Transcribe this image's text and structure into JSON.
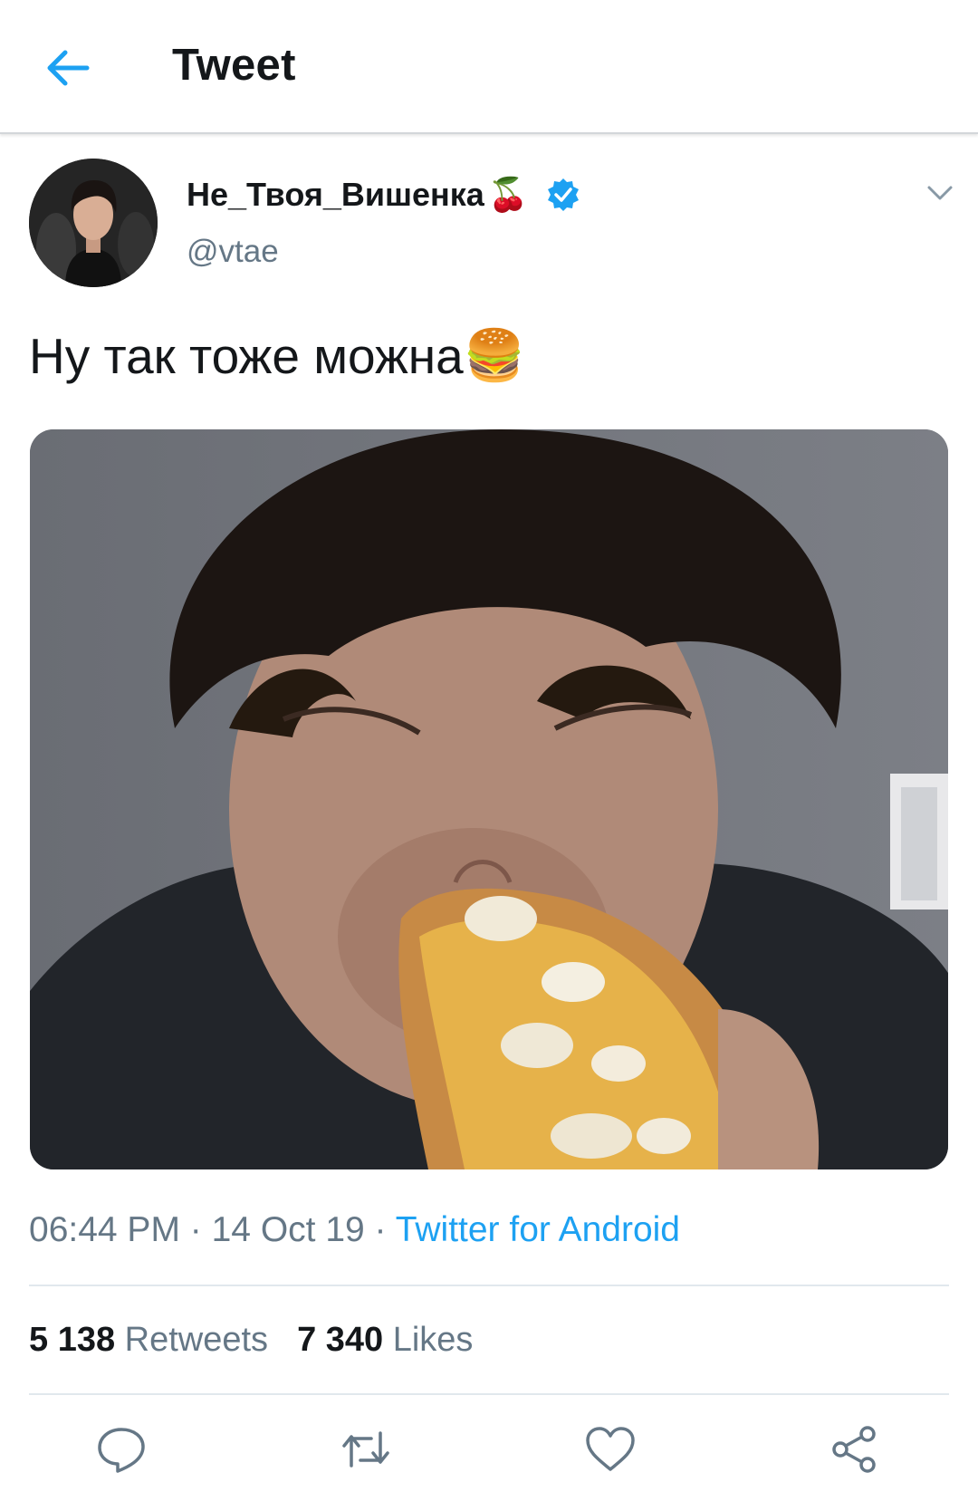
{
  "header": {
    "title": "Tweet",
    "back_icon": "arrow-left-icon"
  },
  "author": {
    "display_name": "Не_Твоя_Вишенка",
    "name_emoji": "🍒",
    "verified": true,
    "handle": "@vtae"
  },
  "tweet": {
    "text": "Ну так тоже можна",
    "text_emoji": "🍔"
  },
  "meta": {
    "time": "06:44 PM",
    "sep1": " · ",
    "date": "14 Oct 19",
    "sep2": " · ",
    "source": "Twitter for Android"
  },
  "stats": {
    "retweets_count": "5 138",
    "retweets_label": "Retweets",
    "likes_count": "7 340",
    "likes_label": "Likes"
  },
  "actions": [
    "reply-icon",
    "retweet-icon",
    "like-icon",
    "share-icon"
  ],
  "colors": {
    "accent": "#1da1f2",
    "text_primary": "#14171a",
    "text_secondary": "#657786",
    "divider": "#e1e8ed"
  }
}
